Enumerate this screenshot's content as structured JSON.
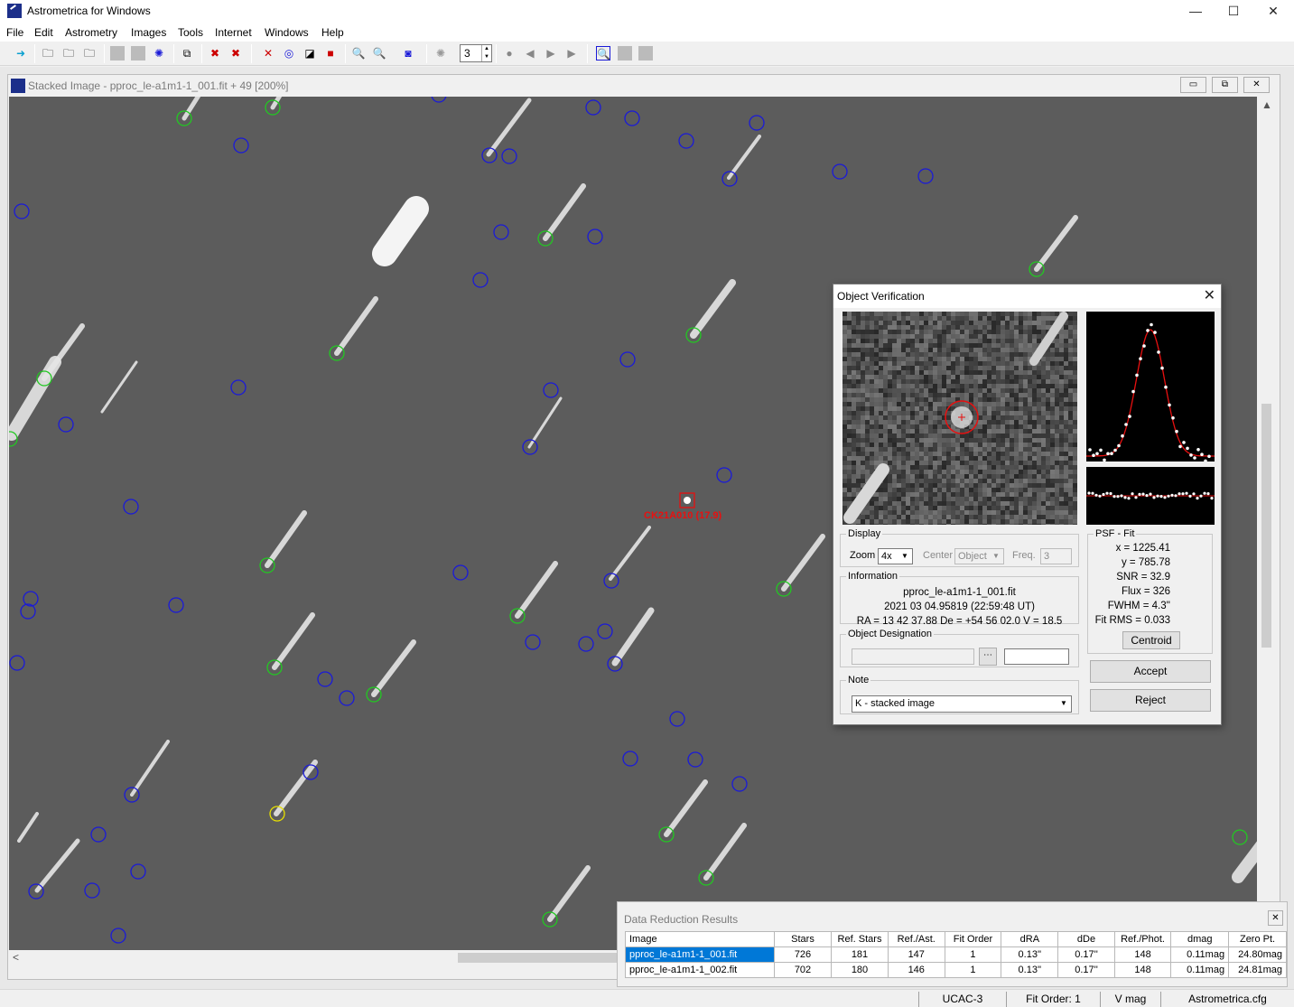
{
  "app": {
    "title": "Astrometrica for Windows",
    "minimize": "—",
    "maximize": "☐",
    "close": "✕"
  },
  "menu": [
    "File",
    "Edit",
    "Astrometry",
    "Images",
    "Tools",
    "Internet",
    "Windows",
    "Help"
  ],
  "toolbar": {
    "frame_spin": "3"
  },
  "image_window": {
    "title": "Stacked Image - pproc_le-a1m1-1_001.fit + 49 [200%]",
    "target_label": "CK21A010 (17.9)",
    "colors": {
      "background": "#5c5c5c",
      "reference_star": "#1a1ad8",
      "matched_star": "#22c822",
      "target": "#e81010",
      "highlight": "#e8e000"
    }
  },
  "verify": {
    "title": "Object Verification",
    "display": {
      "legend": "Display",
      "zoom_label": "Zoom",
      "zoom_value": "4x",
      "center_label": "Center",
      "center_value": "Object",
      "freq_label": "Freq.",
      "freq_value": "3"
    },
    "information": {
      "legend": "Information",
      "file": "pproc_le-a1m1-1_001.fit",
      "date": "2021 03 04.95819 (22:59:48 UT)",
      "coords": "RA = 13 42 37.88   De = +54 56 02.0   V = 18.5"
    },
    "designation": {
      "legend": "Object Designation",
      "value": "",
      "extra": ""
    },
    "note": {
      "legend": "Note",
      "value": "K - stacked image"
    },
    "psf": {
      "legend": "PSF - Fit",
      "lines": [
        "x = 1225.41",
        "y = 785.78",
        "SNR = 32.9",
        "Flux = 326",
        "FWHM = 4.3''",
        "Fit RMS = 0.033"
      ],
      "centroid_button": "Centroid"
    },
    "accept_button": "Accept",
    "reject_button": "Reject"
  },
  "results": {
    "title": "Data Reduction Results",
    "columns": [
      "Image",
      "Stars",
      "Ref. Stars",
      "Ref./Ast.",
      "Fit Order",
      "dRA",
      "dDe",
      "Ref./Phot.",
      "dmag",
      "Zero Pt."
    ],
    "rows": [
      [
        "pproc_le-a1m1-1_001.fit",
        "726",
        "181",
        "147",
        "1",
        "0.13''",
        "0.17''",
        "148",
        "0.11mag",
        "24.80mag"
      ],
      [
        "pproc_le-a1m1-1_002.fit",
        "702",
        "180",
        "146",
        "1",
        "0.13''",
        "0.17''",
        "148",
        "0.11mag",
        "24.81mag"
      ]
    ]
  },
  "status": [
    "UCAC-3",
    "Fit Order: 1",
    "V mag",
    "Astrometrica.cfg"
  ]
}
